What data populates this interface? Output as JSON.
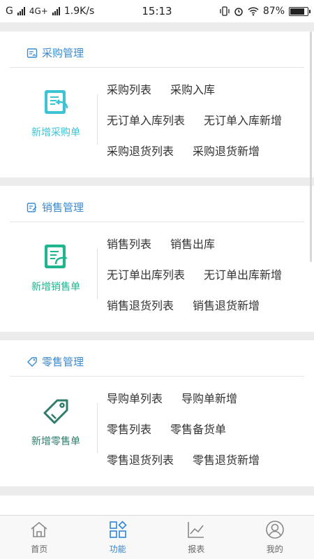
{
  "statusbar": {
    "carrier": "G",
    "network": "4G+",
    "speed": "1.9K/s",
    "time": "15:13",
    "battery_text": "87%",
    "battery_level": 0.87
  },
  "sections": [
    {
      "title": "采购管理",
      "icon": "purchase-doc-icon",
      "main_label": "新增采购单",
      "main_color": "#3cc4d4",
      "links": [
        [
          "采购列表",
          "采购入库"
        ],
        [
          "无订单入库列表",
          "无订单入库新增"
        ],
        [
          "采购退货列表",
          "采购退货新增"
        ]
      ]
    },
    {
      "title": "销售管理",
      "icon": "sales-doc-icon",
      "main_label": "新增销售单",
      "main_color": "#1fb58f",
      "links": [
        [
          "销售列表",
          "销售出库"
        ],
        [
          "无订单出库列表",
          "无订单出库新增"
        ],
        [
          "销售退货列表",
          "销售退货新增"
        ]
      ]
    },
    {
      "title": "零售管理",
      "icon": "tag-icon",
      "main_label": "新增零售单",
      "main_color": "#2e7d6b",
      "links": [
        [
          "导购单列表",
          "导购单新增"
        ],
        [
          "零售列表",
          "零售备货单"
        ],
        [
          "零售退货列表",
          "零售退货新增"
        ]
      ]
    }
  ],
  "tabs": [
    {
      "label": "首页",
      "icon": "home-icon"
    },
    {
      "label": "功能",
      "icon": "grid-icon"
    },
    {
      "label": "报表",
      "icon": "chart-icon"
    },
    {
      "label": "我的",
      "icon": "user-icon"
    }
  ],
  "colors": {
    "accent": "#2f86d8",
    "header_text": "#3a8bd0"
  }
}
